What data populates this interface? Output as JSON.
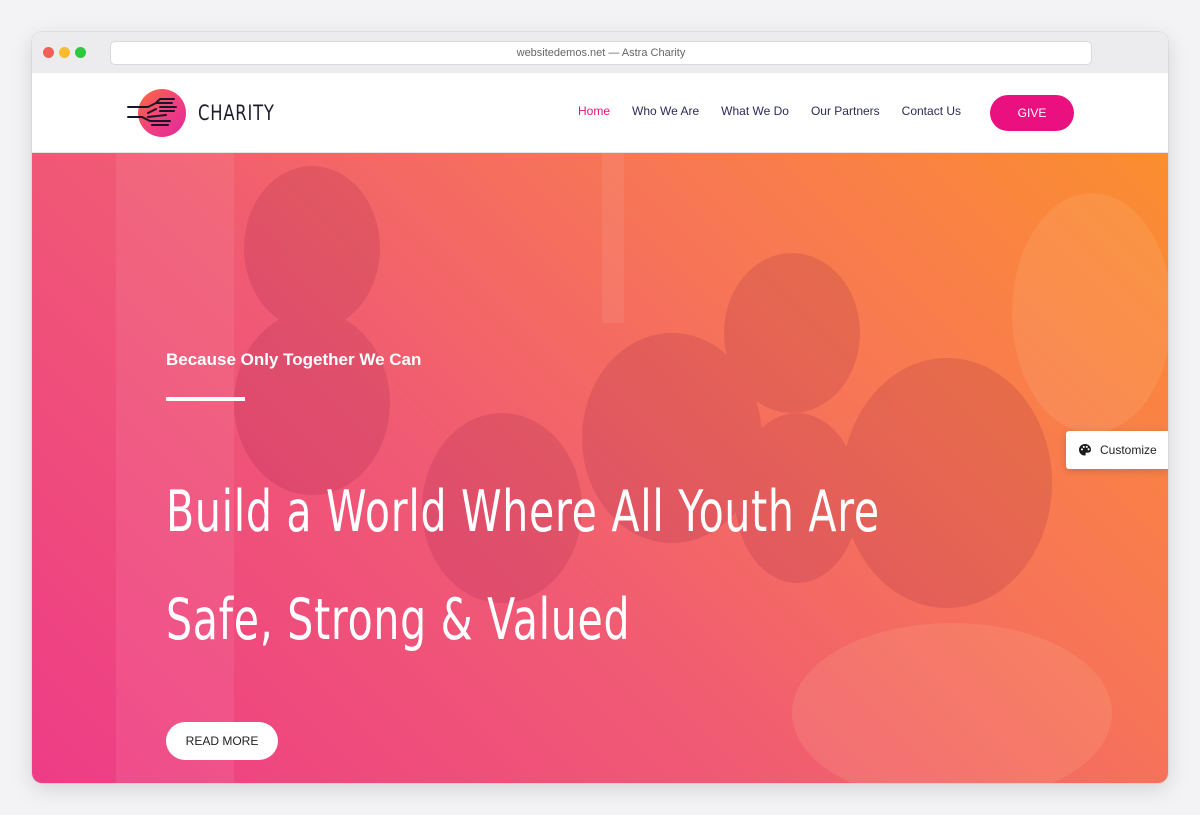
{
  "browser": {
    "url_text": "websitedemos.net — Astra Charity"
  },
  "header": {
    "logo_text": "CHARITY",
    "nav": [
      {
        "label": "Home",
        "active": true
      },
      {
        "label": "Who We Are"
      },
      {
        "label": "What We Do"
      },
      {
        "label": "Our Partners"
      },
      {
        "label": "Contact Us"
      }
    ],
    "give_label": "GIVE"
  },
  "hero": {
    "tagline": "Because Only Together We Can",
    "headline_line1": "Build a World Where All Youth Are",
    "headline_line2": "Safe, Strong & Valued",
    "button_label": "READ MORE"
  },
  "customize": {
    "label": "Customize",
    "icon": "palette-icon"
  },
  "colors": {
    "accent": "#ea1080",
    "nav_text": "#2a2a5a",
    "hero_gradient_start": "#ee3c86",
    "hero_gradient_end": "#fb8e2f"
  }
}
